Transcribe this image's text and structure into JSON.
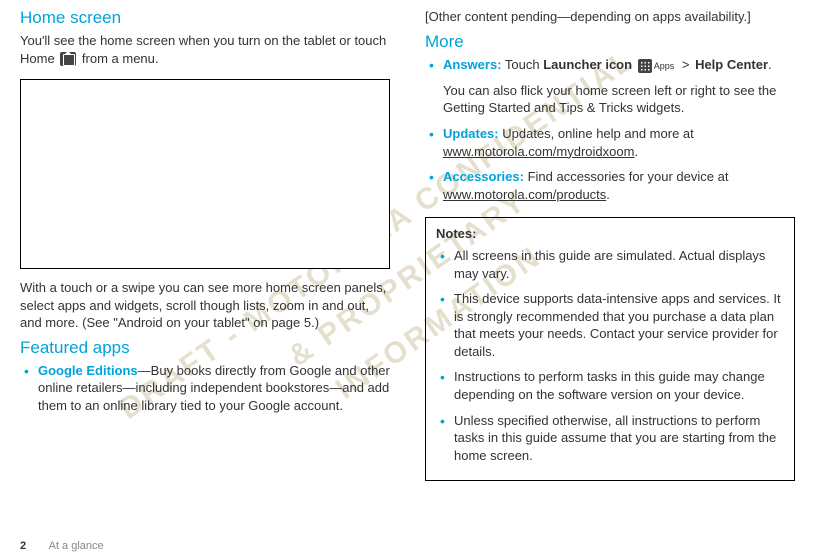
{
  "left": {
    "heading1": "Home screen",
    "p1_a": "You'll see the home screen when you turn on the tablet or touch Home ",
    "p1_b": " from a menu.",
    "p2": "With a touch or a swipe you can see more home screen panels, select apps and widgets, scroll though lists, zoom in and out, and more. (See \"Android on your tablet\" on page 5.)",
    "heading2": "Featured apps",
    "featured": {
      "label": "Google Editions",
      "text": "—Buy books directly from Google and other online retailers—including independent bookstores—and add them to an online library tied to your Google account."
    }
  },
  "right": {
    "pending": "[Other content pending—depending on apps availability.]",
    "heading": "More",
    "answers": {
      "label": "Answers:",
      "text_a": " Touch ",
      "launcher": "Launcher icon",
      "apps": "Apps",
      "gt": ">",
      "help": "Help Center",
      "dot": ".",
      "p2": "You can also flick your home screen left or right to see the Getting Started and Tips & Tricks widgets."
    },
    "updates": {
      "label": "Updates:",
      "text": " Updates, online help and more at ",
      "url": "www.motorola.com/mydroidxoom",
      "dot": "."
    },
    "accessories": {
      "label": "Accessories:",
      "text": " Find accessories for your device at ",
      "url": "www.motorola.com/products",
      "dot": "."
    },
    "notes": {
      "title": "Notes:",
      "items": [
        "All screens in this guide are simulated. Actual displays may vary.",
        "This device supports data-intensive apps and services. It is strongly recommended that you purchase a data plan that meets your needs. Contact your service provider for details.",
        "Instructions to perform tasks in this guide may change depending on the software version on your device.",
        "Unless specified otherwise, all instructions to perform tasks in this guide assume that you are starting from the home screen."
      ]
    }
  },
  "footer": {
    "page": "2",
    "section": "At a glance"
  },
  "watermark": {
    "line1": "DRAFT - MOTOROLA CONFIDENTIAL",
    "line2": "& PROPRIETARY",
    "line3": "INFORMATION"
  }
}
